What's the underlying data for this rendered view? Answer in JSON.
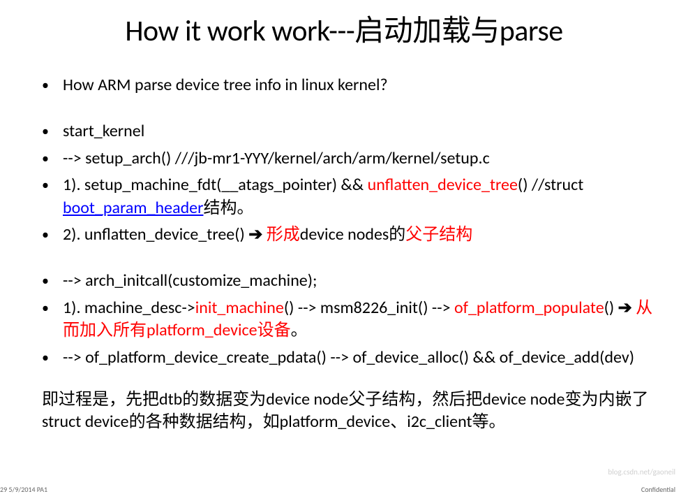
{
  "title": "How it work work---启动加载与parse",
  "bullets": {
    "b1": "How ARM parse device tree info in linux kernel?",
    "b2": "start_kernel",
    "b3": "--> setup_arch() ///jb-mr1-YYY/kernel/arch/arm/kernel/setup.c",
    "b4_p1": "1). setup_machine_fdt(__atags_pointer)  && ",
    "b4_p2": "unflatten_device_tree",
    "b4_p3": "()      //struct ",
    "b4_p4": "boot_param_header",
    "b4_p5": "结构。",
    "b5_p1": "2). unflatten_device_tree()  ",
    "b5_arrow": "➔",
    "b5_p2": " 形成",
    "b5_p3": "device nodes的",
    "b5_p4": "父子结构",
    "b6": "--> arch_initcall(customize_machine);",
    "b7_p1": "1). machine_desc->",
    "b7_p2": "init_machine",
    "b7_p3": "()  --> msm8226_init() --> ",
    "b7_p4": "of_platform_populate",
    "b7_p5": "()       ",
    "b7_arrow": "➔",
    "b7_p6": " 从而加入所有platform_device设备",
    "b7_p7": "。",
    "b8": "  --> of_platform_device_create_pdata()  --> of_device_alloc()  &&  of_device_add(dev)"
  },
  "summary": "即过程是，先把dtb的数据变为device node父子结构，然后把device node变为内嵌了struct device的各种数据结构，如platform_device、i2c_client等。",
  "footer": {
    "left": "29    5/9/2014      PA1",
    "right": "Confidential",
    "watermark": "blog.csdn.net/gaoneil"
  }
}
